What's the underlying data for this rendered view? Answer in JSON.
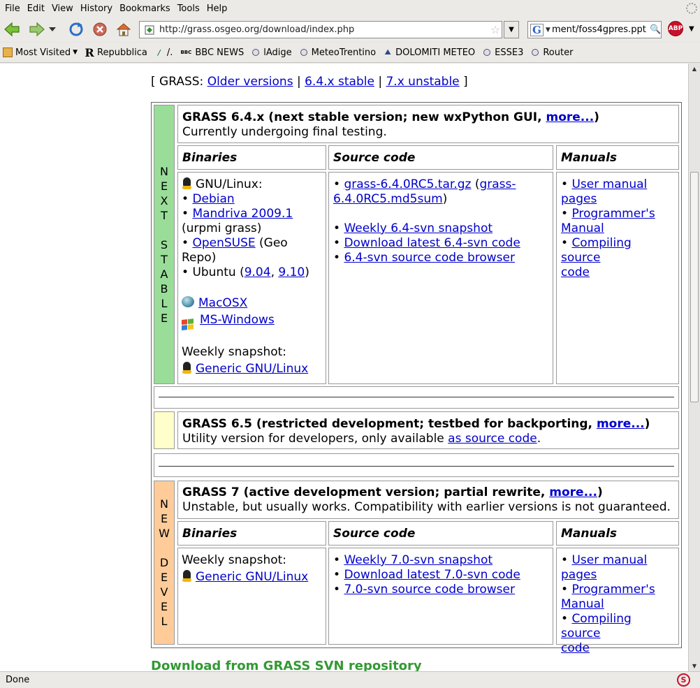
{
  "menu": [
    {
      "label": "File",
      "u": "F",
      "rest": "ile"
    },
    {
      "label": "Edit",
      "u": "E",
      "rest": "dit"
    },
    {
      "label": "View",
      "u": "V",
      "rest": "iew"
    },
    {
      "label": "History",
      "pre": "Hi",
      "u": "s",
      "rest": "tory"
    },
    {
      "label": "Bookmarks",
      "u": "B",
      "rest": "ookmarks"
    },
    {
      "label": "Tools",
      "u": "T",
      "rest": "ools"
    },
    {
      "label": "Help",
      "u": "H",
      "rest": "elp"
    }
  ],
  "menu_labels": {
    "file": "File",
    "edit": "Edit",
    "view": "View",
    "history": "History",
    "bookmarks": "Bookmarks",
    "tools": "Tools",
    "help": "Help"
  },
  "toolbar": {
    "url": "http://grass.osgeo.org/download/index.php",
    "search_value": "ment/foss4gpres.ppt",
    "search_engine": "G",
    "abp_label": "ABP"
  },
  "bookmarks": [
    "Most Visited",
    "Repubblica",
    "/.",
    "BBC NEWS",
    "lAdige",
    "MeteoTrentino",
    "DOLOMITI METEO",
    "ESSE3",
    "Router"
  ],
  "bookmark_icons": {
    "repubblica": "R",
    "bbc": "BBC"
  },
  "status": {
    "text": "Done"
  },
  "page": {
    "top_prefix": "[ GRASS:",
    "top_links": [
      "Older versions",
      "6.4.x stable",
      "7.x unstable"
    ],
    "top_sep": "|",
    "top_suffix": "]",
    "section1": {
      "side_letters": [
        "N",
        "E",
        "X",
        "T",
        "",
        "S",
        "T",
        "A",
        "B",
        "L",
        "E"
      ],
      "title": "GRASS 6.4.x (next stable version; new wxPython GUI, ",
      "title_link": "more...",
      "title_end": ")",
      "subtitle": "Currently undergoing final testing.",
      "col_binaries": "Binaries",
      "col_source": "Source code",
      "col_manuals": "Manuals",
      "bin_gnulinux": "GNU/Linux:",
      "bin_debian": "Debian",
      "bin_mandriva": "Mandriva 2009.1",
      "bin_mandriva_note": "(urpmi grass)",
      "bin_opensuse": "OpenSUSE",
      "bin_opensuse_note1": "(Geo",
      "bin_opensuse_note2": "Repo)",
      "bin_ubuntu": "Ubuntu (",
      "bin_ubuntu_v1": "9.04",
      "bin_ubuntu_comma": ", ",
      "bin_ubuntu_v2": "9.10",
      "bin_ubuntu_end": ")",
      "bin_macosx": "MacOSX",
      "bin_mswindows": "MS-Windows",
      "bin_weekly": "Weekly snapshot:",
      "bin_generic": "Generic GNU/Linux",
      "src_tarball_1": "grass-6.4.0RC5.tar.gz",
      "src_tarball_open": "(",
      "src_md5_a": "grass-",
      "src_md5_b": "6.4.0RC5.md5sum",
      "src_md5_close": ")",
      "src_weekly": "Weekly 6.4-svn snapshot",
      "src_download": "Download latest 6.4-svn code",
      "src_browser": "6.4-svn source code browser",
      "man_user_a": "User manual",
      "man_user_b": "pages",
      "man_prog_a": "Programmer's",
      "man_prog_b": "Manual",
      "man_comp_a": "Compiling source",
      "man_comp_b": "code"
    },
    "section2": {
      "title": "GRASS 6.5 (restricted development; testbed for backporting, ",
      "title_link": "more...",
      "title_end": ")",
      "subtitle_pre": "Utility version for developers, only available ",
      "subtitle_link": "as source code",
      "subtitle_post": "."
    },
    "section3": {
      "side_letters": [
        "N",
        "E",
        "W",
        "",
        "D",
        "E",
        "V",
        "E",
        "L"
      ],
      "title": "GRASS 7 (active development version; partial rewrite, ",
      "title_link": "more...",
      "title_end": ")",
      "subtitle": "Unstable, but usually works. Compatibility with earlier versions is not guaranteed.",
      "col_binaries": "Binaries",
      "col_source": "Source code",
      "col_manuals": "Manuals",
      "bin_weekly": "Weekly snapshot:",
      "bin_generic": "Generic GNU/Linux",
      "src_weekly": "Weekly 7.0-svn snapshot",
      "src_download": "Download latest 7.0-svn code",
      "src_browser": "7.0-svn source code browser",
      "man_user_a": "User manual",
      "man_user_b": "pages",
      "man_prog_a": "Programmer's",
      "man_prog_b": "Manual",
      "man_comp_a": "Compiling source",
      "man_comp_b": "code"
    },
    "bottom_heading": "Download from GRASS SVN repository"
  },
  "colors": {
    "next_stable_side": "#99dd99",
    "restricted_side": "#ffffcc",
    "new_devel_side": "#ffcc99",
    "link": "#0000cc",
    "visited": "#551a8b",
    "heading_green": "#339933"
  }
}
